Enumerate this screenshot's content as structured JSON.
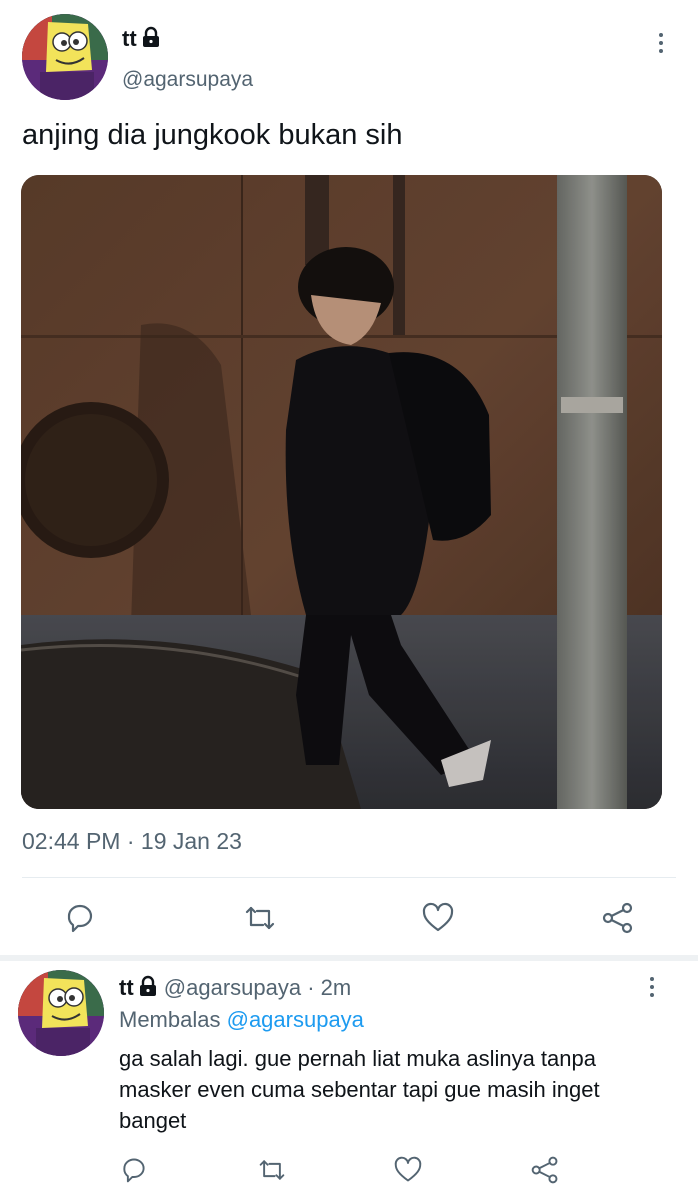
{
  "tweet": {
    "author_name": "tt",
    "author_handle": "@agarsupaya",
    "text": "anjing dia jungkook bukan sih",
    "time": "02:44 PM",
    "separator": "·",
    "date": "19 Jan 23",
    "photo_icon": "photo-image"
  },
  "actions": [
    "reply-icon",
    "retweet-icon",
    "like-icon",
    "share-icon"
  ],
  "reply": {
    "author_name": "tt",
    "author_handle": "@agarsupaya",
    "separator": "·",
    "age": "2m",
    "replying_prefix": "Membalas",
    "replying_to": "@agarsupaya",
    "text": "ga salah lagi. gue pernah liat muka aslinya tanpa masker even cuma sebentar tapi gue masih inget banget"
  },
  "colors": {
    "accent": "#1d9bf0",
    "secondary_text": "#536471",
    "primary_text": "#0f1419"
  }
}
